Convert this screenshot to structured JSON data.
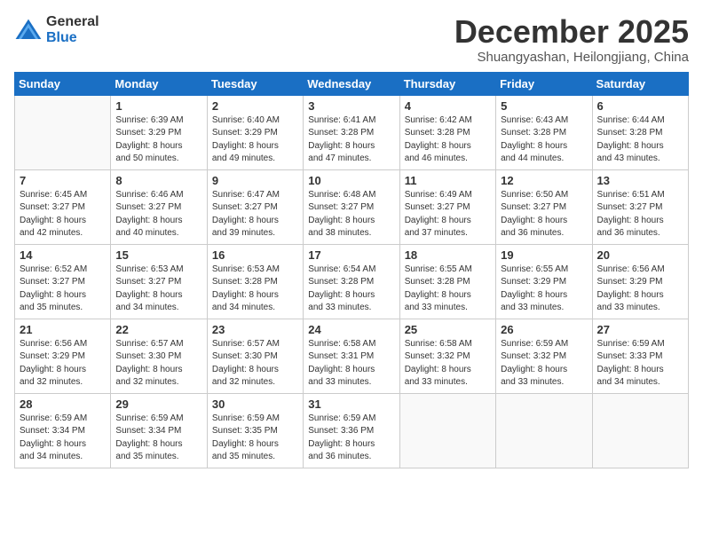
{
  "logo": {
    "general": "General",
    "blue": "Blue"
  },
  "header": {
    "month": "December 2025",
    "location": "Shuangyashan, Heilongjiang, China"
  },
  "days_of_week": [
    "Sunday",
    "Monday",
    "Tuesday",
    "Wednesday",
    "Thursday",
    "Friday",
    "Saturday"
  ],
  "weeks": [
    [
      {
        "day": "",
        "info": ""
      },
      {
        "day": "1",
        "info": "Sunrise: 6:39 AM\nSunset: 3:29 PM\nDaylight: 8 hours\nand 50 minutes."
      },
      {
        "day": "2",
        "info": "Sunrise: 6:40 AM\nSunset: 3:29 PM\nDaylight: 8 hours\nand 49 minutes."
      },
      {
        "day": "3",
        "info": "Sunrise: 6:41 AM\nSunset: 3:28 PM\nDaylight: 8 hours\nand 47 minutes."
      },
      {
        "day": "4",
        "info": "Sunrise: 6:42 AM\nSunset: 3:28 PM\nDaylight: 8 hours\nand 46 minutes."
      },
      {
        "day": "5",
        "info": "Sunrise: 6:43 AM\nSunset: 3:28 PM\nDaylight: 8 hours\nand 44 minutes."
      },
      {
        "day": "6",
        "info": "Sunrise: 6:44 AM\nSunset: 3:28 PM\nDaylight: 8 hours\nand 43 minutes."
      }
    ],
    [
      {
        "day": "7",
        "info": "Sunrise: 6:45 AM\nSunset: 3:27 PM\nDaylight: 8 hours\nand 42 minutes."
      },
      {
        "day": "8",
        "info": "Sunrise: 6:46 AM\nSunset: 3:27 PM\nDaylight: 8 hours\nand 40 minutes."
      },
      {
        "day": "9",
        "info": "Sunrise: 6:47 AM\nSunset: 3:27 PM\nDaylight: 8 hours\nand 39 minutes."
      },
      {
        "day": "10",
        "info": "Sunrise: 6:48 AM\nSunset: 3:27 PM\nDaylight: 8 hours\nand 38 minutes."
      },
      {
        "day": "11",
        "info": "Sunrise: 6:49 AM\nSunset: 3:27 PM\nDaylight: 8 hours\nand 37 minutes."
      },
      {
        "day": "12",
        "info": "Sunrise: 6:50 AM\nSunset: 3:27 PM\nDaylight: 8 hours\nand 36 minutes."
      },
      {
        "day": "13",
        "info": "Sunrise: 6:51 AM\nSunset: 3:27 PM\nDaylight: 8 hours\nand 36 minutes."
      }
    ],
    [
      {
        "day": "14",
        "info": "Sunrise: 6:52 AM\nSunset: 3:27 PM\nDaylight: 8 hours\nand 35 minutes."
      },
      {
        "day": "15",
        "info": "Sunrise: 6:53 AM\nSunset: 3:27 PM\nDaylight: 8 hours\nand 34 minutes."
      },
      {
        "day": "16",
        "info": "Sunrise: 6:53 AM\nSunset: 3:28 PM\nDaylight: 8 hours\nand 34 minutes."
      },
      {
        "day": "17",
        "info": "Sunrise: 6:54 AM\nSunset: 3:28 PM\nDaylight: 8 hours\nand 33 minutes."
      },
      {
        "day": "18",
        "info": "Sunrise: 6:55 AM\nSunset: 3:28 PM\nDaylight: 8 hours\nand 33 minutes."
      },
      {
        "day": "19",
        "info": "Sunrise: 6:55 AM\nSunset: 3:29 PM\nDaylight: 8 hours\nand 33 minutes."
      },
      {
        "day": "20",
        "info": "Sunrise: 6:56 AM\nSunset: 3:29 PM\nDaylight: 8 hours\nand 33 minutes."
      }
    ],
    [
      {
        "day": "21",
        "info": "Sunrise: 6:56 AM\nSunset: 3:29 PM\nDaylight: 8 hours\nand 32 minutes."
      },
      {
        "day": "22",
        "info": "Sunrise: 6:57 AM\nSunset: 3:30 PM\nDaylight: 8 hours\nand 32 minutes."
      },
      {
        "day": "23",
        "info": "Sunrise: 6:57 AM\nSunset: 3:30 PM\nDaylight: 8 hours\nand 32 minutes."
      },
      {
        "day": "24",
        "info": "Sunrise: 6:58 AM\nSunset: 3:31 PM\nDaylight: 8 hours\nand 33 minutes."
      },
      {
        "day": "25",
        "info": "Sunrise: 6:58 AM\nSunset: 3:32 PM\nDaylight: 8 hours\nand 33 minutes."
      },
      {
        "day": "26",
        "info": "Sunrise: 6:59 AM\nSunset: 3:32 PM\nDaylight: 8 hours\nand 33 minutes."
      },
      {
        "day": "27",
        "info": "Sunrise: 6:59 AM\nSunset: 3:33 PM\nDaylight: 8 hours\nand 34 minutes."
      }
    ],
    [
      {
        "day": "28",
        "info": "Sunrise: 6:59 AM\nSunset: 3:34 PM\nDaylight: 8 hours\nand 34 minutes."
      },
      {
        "day": "29",
        "info": "Sunrise: 6:59 AM\nSunset: 3:34 PM\nDaylight: 8 hours\nand 35 minutes."
      },
      {
        "day": "30",
        "info": "Sunrise: 6:59 AM\nSunset: 3:35 PM\nDaylight: 8 hours\nand 35 minutes."
      },
      {
        "day": "31",
        "info": "Sunrise: 6:59 AM\nSunset: 3:36 PM\nDaylight: 8 hours\nand 36 minutes."
      },
      {
        "day": "",
        "info": ""
      },
      {
        "day": "",
        "info": ""
      },
      {
        "day": "",
        "info": ""
      }
    ]
  ]
}
